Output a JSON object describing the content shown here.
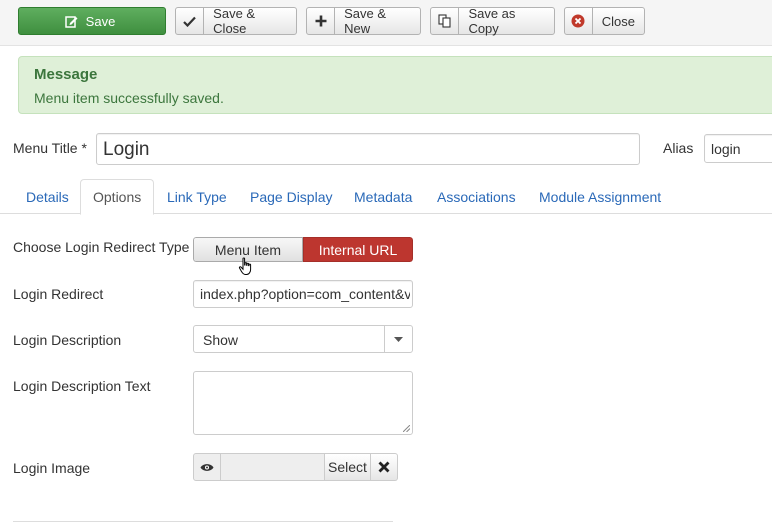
{
  "toolbar": {
    "save": "Save",
    "save_close": "Save & Close",
    "save_new": "Save & New",
    "save_copy": "Save as Copy",
    "close": "Close"
  },
  "message": {
    "heading": "Message",
    "text": "Menu item successfully saved."
  },
  "header_fields": {
    "title_label": "Menu Title *",
    "title_value": "Login",
    "alias_label": "Alias",
    "alias_value": "login"
  },
  "tabs": [
    {
      "label": "Details",
      "active": false
    },
    {
      "label": "Options",
      "active": true
    },
    {
      "label": "Link Type",
      "active": false
    },
    {
      "label": "Page Display",
      "active": false
    },
    {
      "label": "Metadata",
      "active": false
    },
    {
      "label": "Associations",
      "active": false
    },
    {
      "label": "Module Assignment",
      "active": false
    }
  ],
  "form": {
    "redirect_type_label": "Choose Login Redirect Type",
    "redirect_type_options": [
      "Menu Item",
      "Internal URL"
    ],
    "redirect_type_selected": "Internal URL",
    "redirect_label": "Login Redirect",
    "redirect_value": "index.php?option=com_content&view",
    "description_label": "Login Description",
    "description_value": "Show",
    "description_text_label": "Login Description Text",
    "description_text_value": "",
    "image_label": "Login Image",
    "image_select": "Select"
  },
  "colors": {
    "primary_green": "#4a9e4a",
    "active_red": "#bd362f",
    "link_blue": "#2a69b8",
    "alert_bg": "#dff0d8",
    "alert_text": "#3c763d"
  },
  "icons": [
    "edit-icon",
    "check-icon",
    "plus-icon",
    "copy-icon",
    "close-circle-icon",
    "eye-icon",
    "caret-down-icon",
    "times-icon",
    "cursor-hand-icon"
  ]
}
